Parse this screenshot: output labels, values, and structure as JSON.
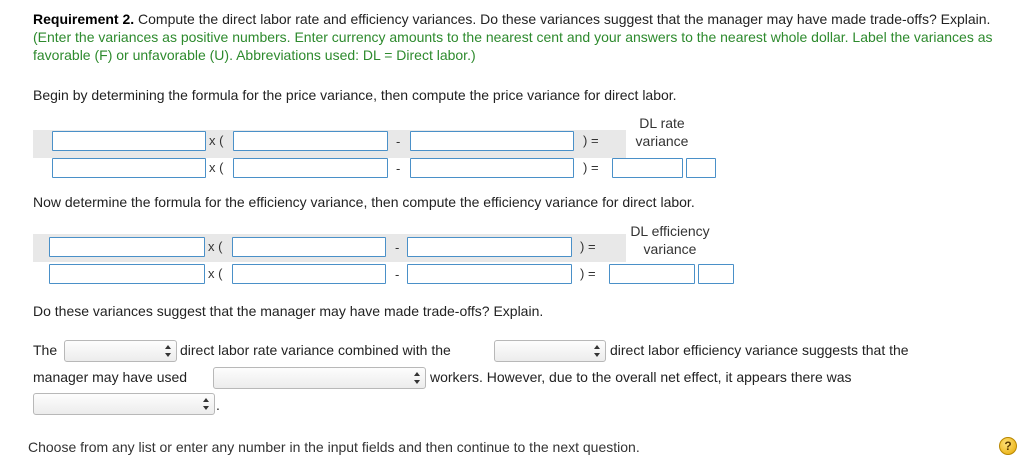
{
  "requirement": {
    "bold": "Requirement 2.",
    "text": " Compute the direct labor rate and efficiency variances. Do these variances suggest that the manager may have made trade-offs? Explain.",
    "instructions": "(Enter the variances as positive numbers. Enter currency amounts to the nearest cent and your answers to the nearest whole dollar. Label the variances as favorable (F) or unfavorable (U). Abbreviations used: DL = Direct labor.)"
  },
  "price_section": {
    "intro": "Begin by determining the formula for the price variance, then compute the price variance for direct labor.",
    "header_line1": "DL rate",
    "header_line2": "variance"
  },
  "efficiency_section": {
    "intro": "Now determine the formula for the efficiency variance, then compute the efficiency variance for direct labor.",
    "header_line1": "DL efficiency",
    "header_line2": "variance"
  },
  "operators": {
    "times_open": "x (",
    "minus": "-",
    "close_eq": ") ="
  },
  "tradeoff": {
    "question": "Do these variances suggest that the manager may have made trade-offs? Explain.",
    "the": "The",
    "rate_combined": "direct labor rate variance combined with the",
    "eff_suggests": "direct labor efficiency variance suggests that the",
    "manager_used": "manager may have used",
    "workers_however": "workers. However, due to the overall net effect, it appears there was",
    "period": "."
  },
  "footer": {
    "text": "Choose from any list or enter any number in the input fields and then continue to the next question.",
    "help": "?"
  }
}
